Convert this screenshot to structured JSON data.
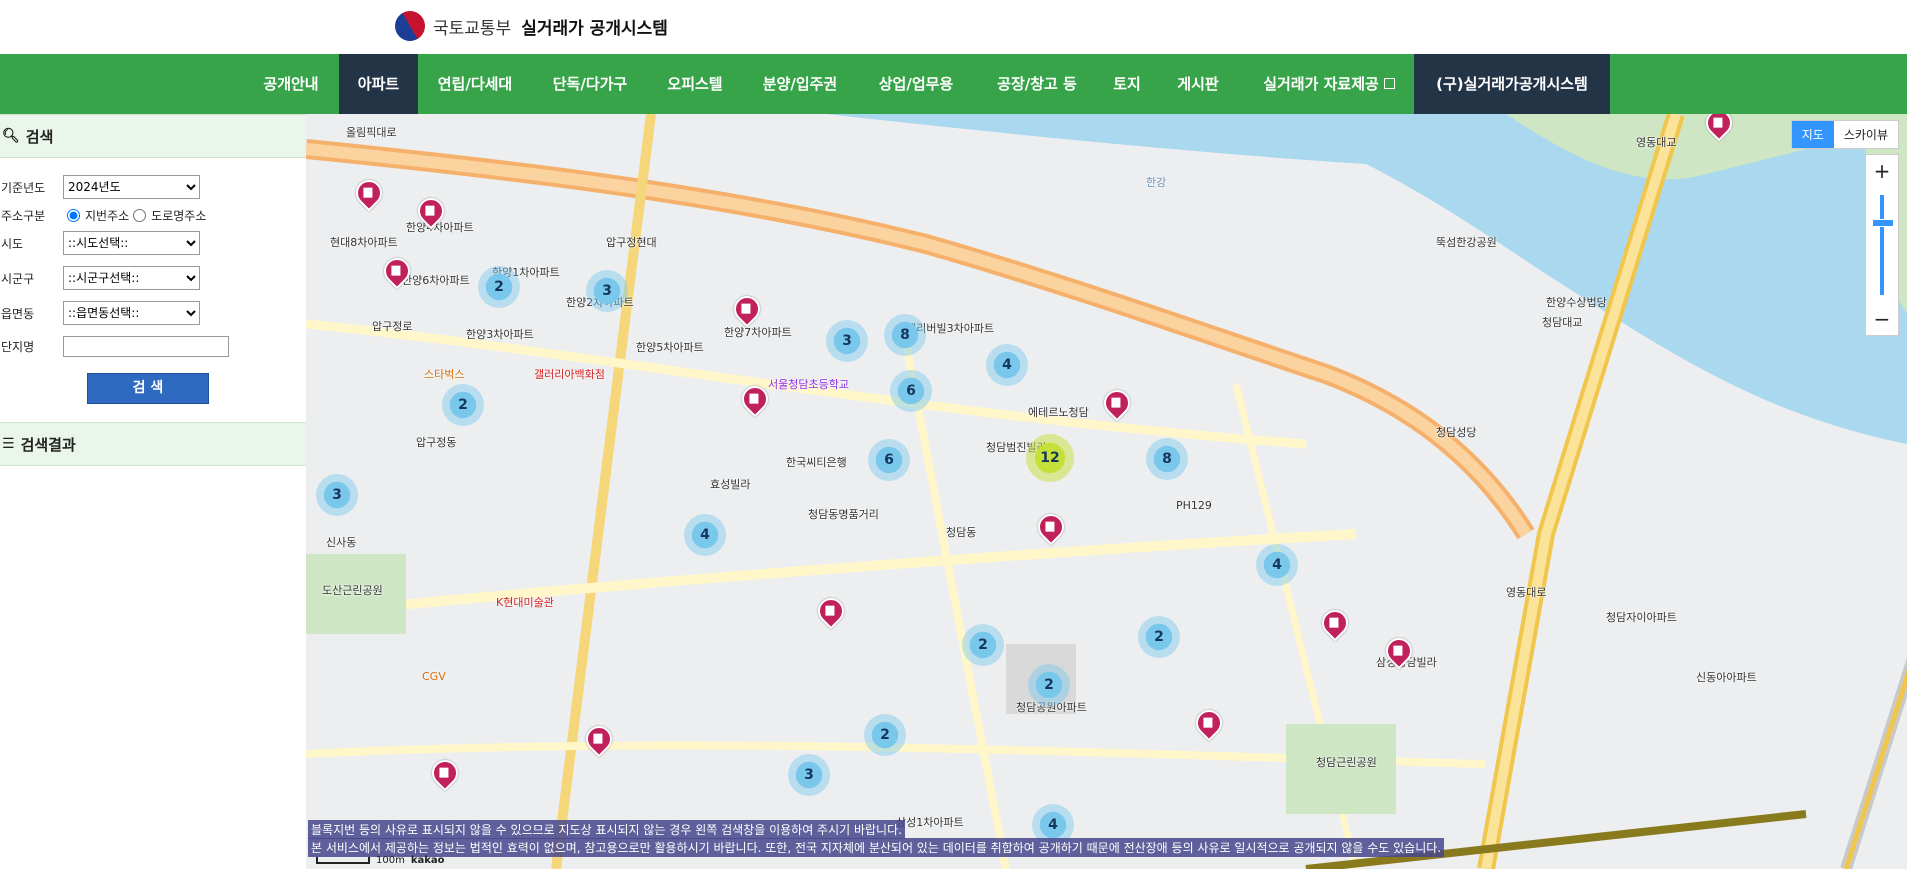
{
  "header": {
    "org": "국토교통부",
    "system": "실거래가 공개시스템"
  },
  "nav": [
    {
      "label": "공개안내",
      "active": false
    },
    {
      "label": "아파트",
      "active": true
    },
    {
      "label": "연립/다세대",
      "active": false
    },
    {
      "label": "단독/다가구",
      "active": false
    },
    {
      "label": "오피스텔",
      "active": false
    },
    {
      "label": "분양/입주권",
      "active": false
    },
    {
      "label": "상업/업무용",
      "active": false
    },
    {
      "label": "공장/창고 등",
      "active": false
    },
    {
      "label": "토지",
      "active": false
    },
    {
      "label": "게시판",
      "active": false
    },
    {
      "label": "실거래가 자료제공",
      "active": false
    },
    {
      "label": "(구)실거래가공개시스템",
      "active": false
    }
  ],
  "search": {
    "title": "검색",
    "year_label": "기준년도",
    "year_value": "2024년도",
    "addr_label": "주소구분",
    "addr_jibun": "지번주소",
    "addr_road": "도로명주소",
    "sido_label": "시도",
    "sido_value": "::시도선택::",
    "sigungu_label": "시군구",
    "sigungu_value": "::시군구선택::",
    "dong_label": "읍면동",
    "dong_value": "::읍면동선택::",
    "complex_label": "단지명",
    "complex_value": "",
    "button": "검 색"
  },
  "results": {
    "title": "검색결과"
  },
  "map": {
    "type_map": "지도",
    "type_sky": "스카이뷰",
    "zoom_in": "+",
    "zoom_out": "−",
    "notice1": "본 서비스에서 제공하는 정보는 법적인 효력이 없으며, 참고용으로만 활용하시기 바랍니다. 또한, 전국 지자체에 분산되어 있는 데이터를 취합하여 공개하기 때문에 전산장애 등의 사유로 일시적으로 공개되지 않을 수도 있습니다.",
    "notice2": "블록지번 등의 사유로 표시되지 않을 수 있으므로 지도상 표시되지 않는 경우 왼쪽 검색창을 이용하여 주시기 바랍니다.",
    "scale": "100m",
    "brand": "kakao",
    "clusters": [
      "2",
      "3",
      "2",
      "3",
      "8",
      "4",
      "6",
      "6",
      "12",
      "8",
      "3",
      "4",
      "4",
      "2",
      "2",
      "2",
      "2",
      "3",
      "4"
    ],
    "labels": [
      "올림픽대로",
      "압구정로",
      "압구정현대",
      "현대8차아파트",
      "한양4차아파트",
      "한양6차아파트",
      "한양1차아파트",
      "한양3차아파트",
      "한양2차아파트",
      "한양5차아파트",
      "한양7차아파트",
      "압구정동",
      "신사동",
      "청담동",
      "서울청담초등학교",
      "연세리버빌3차아파트",
      "에테르노청담",
      "청담범진빌라",
      "PH129",
      "청담동명품거리",
      "스타벅스",
      "갤러리아백화점",
      "CGV",
      "도산근린공원",
      "청담근린공원",
      "삼성청담빌라",
      "청담자이아파트",
      "신동아아파트",
      "한강",
      "뚝섬한강공원",
      "청담대교",
      "영동대교",
      "한양수상법당",
      "영동대로",
      "청담성당",
      "한국씨티은행",
      "K현대미술관",
      "효성빌라",
      "삼성1차아파트",
      "청담공원아파트"
    ]
  }
}
